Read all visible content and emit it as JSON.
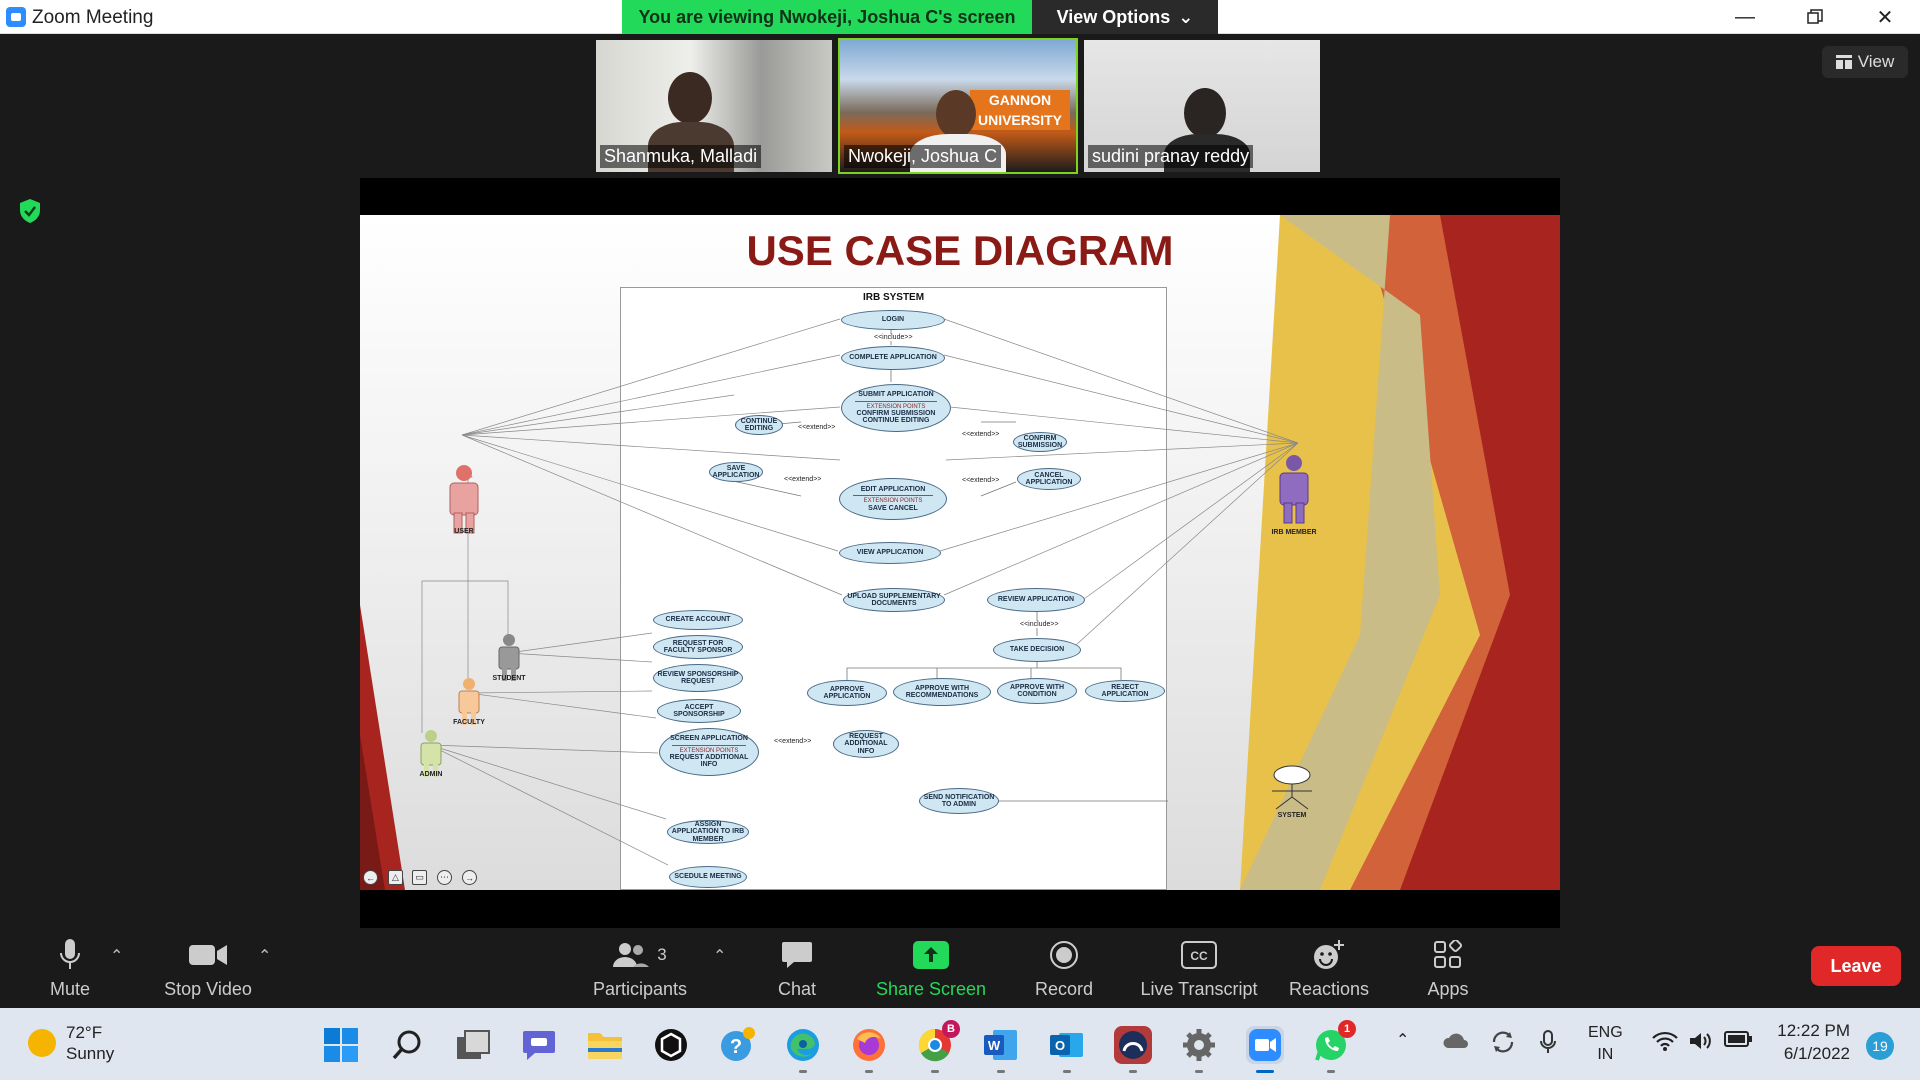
{
  "window": {
    "title": "Zoom Meeting"
  },
  "banner": {
    "viewing": "You are viewing Nwokeji, Joshua C's screen",
    "view_options": "View Options"
  },
  "participants": [
    {
      "name": "Shanmuka, Malladi"
    },
    {
      "name": "Nwokeji, Joshua C",
      "active": true
    },
    {
      "name": "sudini pranay reddy"
    }
  ],
  "view_button": "View",
  "slide": {
    "title": "USE CASE DIAGRAM",
    "system_title": "IRB SYSTEM",
    "actors": {
      "user": "USER",
      "student": "STUDENT",
      "faculty": "FACULTY",
      "admin": "ADMIN",
      "irb_member": "IRB MEMBER",
      "system": "SYSTEM"
    },
    "use_cases": {
      "login": "LOGIN",
      "complete_application": "COMPLETE APPLICATION",
      "submit_application": "SUBMIT APPLICATION",
      "submit_ext": "EXTENSION POINTS",
      "submit_ext_items": "CONFIRM SUBMISSION CONTINUE EDITING",
      "continue_editing": "CONTINUE EDITING",
      "confirm_submission": "CONFIRM SUBMISSION",
      "save_application": "SAVE APPLICATION",
      "edit_application": "EDIT APPLICATION",
      "edit_ext": "EXTENSION POINTS",
      "edit_ext_items": "SAVE CANCEL",
      "cancel_application": "CANCEL APPLICATION",
      "view_application": "VIEW APPLICATION",
      "upload_documents": "UPLOAD SUPPLEMENTARY DOCUMENTS",
      "review_application": "REVIEW APPLICATION",
      "take_decision": "TAKE DECISION",
      "create_account": "CREATE ACCOUNT",
      "request_sponsor": "REQUEST FOR FACULTY SPONSOR",
      "review_sponsorship": "REVIEW SPONSORSHIP REQUEST",
      "accept_sponsorship": "ACCEPT SPONSORSHIP",
      "screen_application": "SCREEN APPLICATION",
      "screen_ext": "EXTENSION POINTS",
      "screen_ext_items": "REQUEST ADDITIONAL INFO",
      "request_info": "REQUEST ADDITIONAL INFO",
      "approve_application": "APPROVE APPLICATION",
      "approve_recommendations": "APPROVE WITH RECOMMENDATIONS",
      "approve_condition": "APPROVE WITH CONDITION",
      "reject_application": "REJECT APPLICATION",
      "send_notification": "SEND NOTIFICATION TO ADMIN",
      "assign_application": "ASSIGN APPLICATION TO IRB MEMBER",
      "schedule_meeting": "SCEDULE MEETING"
    },
    "relations": {
      "include": "<<include>>",
      "extend": "<<extend>>"
    }
  },
  "toolbar": {
    "mute": "Mute",
    "stop_video": "Stop Video",
    "participants": "Participants",
    "participant_count": "3",
    "chat": "Chat",
    "share_screen": "Share Screen",
    "record": "Record",
    "live_transcript": "Live Transcript",
    "reactions": "Reactions",
    "apps": "Apps",
    "leave": "Leave"
  },
  "taskbar": {
    "weather_temp": "72°F",
    "weather_desc": "Sunny",
    "language_line1": "ENG",
    "language_line2": "IN",
    "time": "12:22 PM",
    "date": "6/1/2022",
    "notification_count": "19",
    "chrome_badge": "B",
    "whatsapp_badge": "1"
  },
  "colors": {
    "accent_green": "#23d959",
    "leave_red": "#e02828",
    "slide_title": "#8a1a16"
  }
}
